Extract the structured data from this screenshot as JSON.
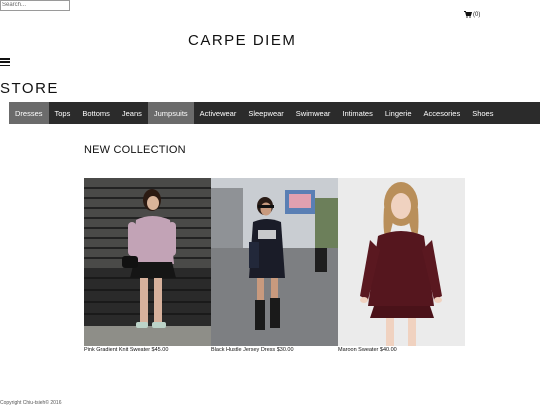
{
  "search": {
    "placeholder": "Search..."
  },
  "cart": {
    "label": "(0)",
    "icon": "shopping-cart-icon"
  },
  "brand": {
    "name": "CARPE DIEM"
  },
  "menu": {
    "icon": "hamburger-menu-icon"
  },
  "store": {
    "title": "STORE"
  },
  "nav": {
    "active_bg": "#6b6b6b",
    "bar_bg": "#2b2b2b",
    "items": [
      {
        "label": "Dresses",
        "active": true
      },
      {
        "label": "Tops",
        "active": false
      },
      {
        "label": "Bottoms",
        "active": false
      },
      {
        "label": "Jeans",
        "active": false
      },
      {
        "label": "Jumpsuits",
        "active": true
      },
      {
        "label": "Activewear",
        "active": false
      },
      {
        "label": "Sleepwear",
        "active": false
      },
      {
        "label": "Swimwear",
        "active": false
      },
      {
        "label": "Intimates",
        "active": false
      },
      {
        "label": "Lingerie",
        "active": false
      },
      {
        "label": "Accesories",
        "active": false
      },
      {
        "label": "Shoes",
        "active": false
      }
    ]
  },
  "collection": {
    "heading": "NEW COLLECTION",
    "products": [
      {
        "caption": "Pink Gradient Knit Sweater $45.00"
      },
      {
        "caption": "Black Hustle Jersey Dress $30.00"
      },
      {
        "caption": "Maroon Sweater $40.00"
      }
    ]
  },
  "footer": {
    "text": "Copyright Chiu-tsieh© 2016"
  }
}
